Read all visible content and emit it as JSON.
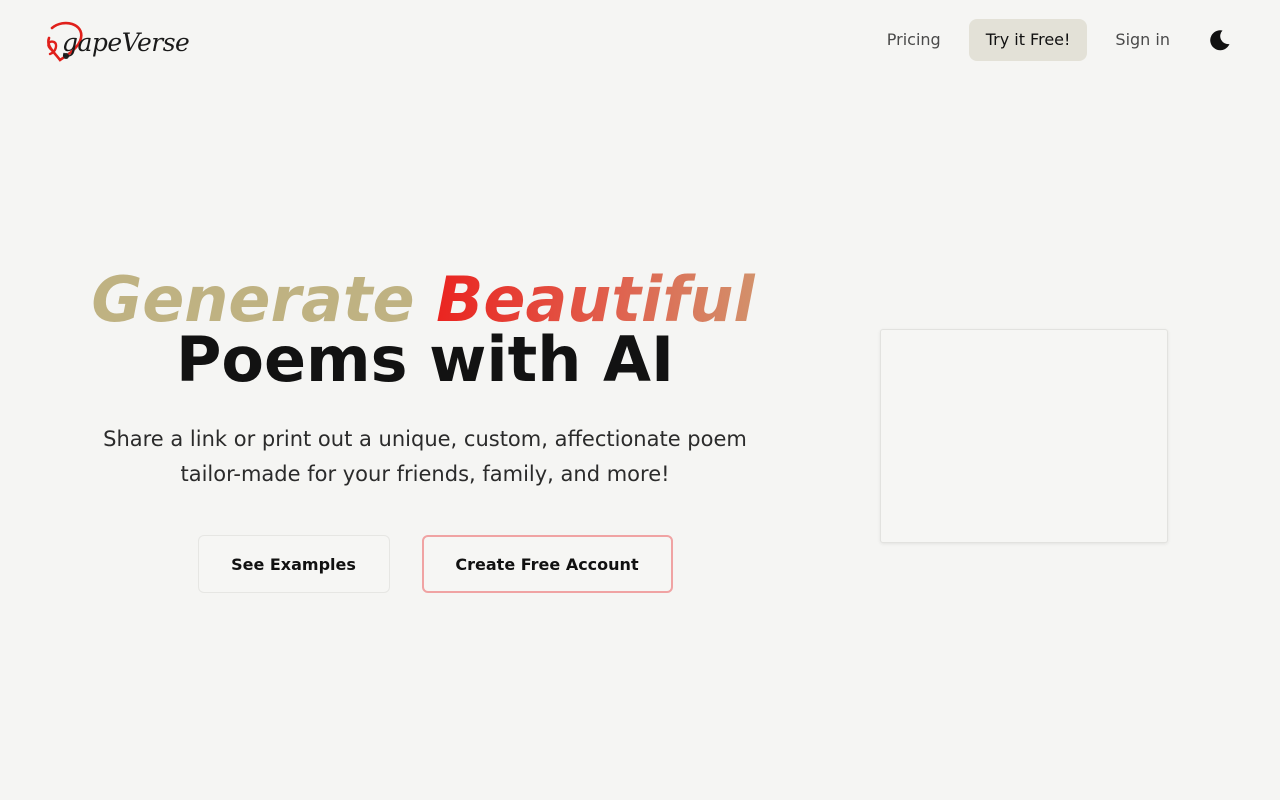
{
  "header": {
    "logo_text": "gapeVerse",
    "logo_icon": "heart-a-logo-icon",
    "nav": {
      "pricing_label": "Pricing",
      "try_label": "Try it Free!",
      "signin_label": "Sign in"
    },
    "theme_icon": "moon-icon"
  },
  "hero": {
    "headline_word1": "Generate",
    "headline_word2": "Beautiful",
    "headline_line2": "Poems with AI",
    "subtitle": "Share a link or print out a unique, custom, affectionate poem tailor-made for your friends, family, and more!",
    "see_examples_label": "See Examples",
    "create_account_label": "Create Free Account"
  },
  "colors": {
    "background": "#f5f5f3",
    "accent_gold": "#bfb282",
    "accent_red": "#ea2420",
    "accent_orange": "#d2926c",
    "cta_bg": "#e3e1d7",
    "primary_border": "#f0a3a3"
  }
}
